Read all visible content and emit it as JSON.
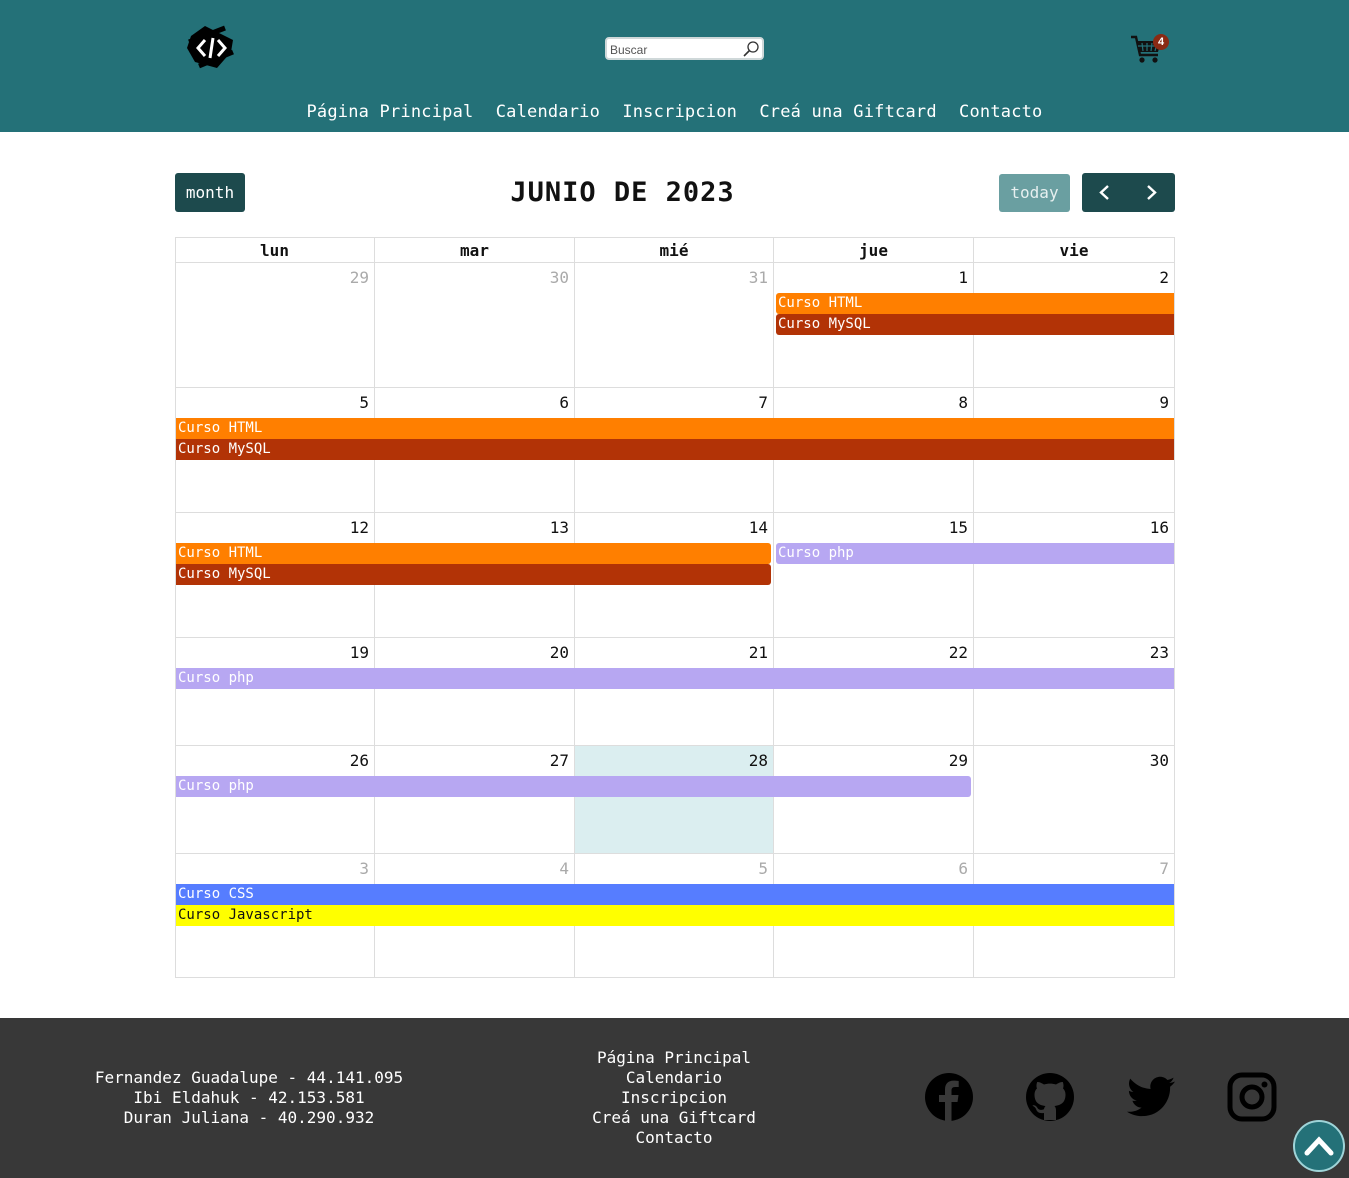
{
  "header": {
    "search_placeholder": "Buscar",
    "cart_count": "4",
    "nav": [
      "Página Principal",
      "Calendario",
      "Inscripcion",
      "Creá una Giftcard",
      "Contacto"
    ]
  },
  "toolbar": {
    "month_label": "month",
    "title": "JUNIO DE 2023",
    "today_label": "today"
  },
  "calendar": {
    "weekdays": [
      "lun",
      "mar",
      "mié",
      "jue",
      "vie"
    ],
    "weeks": [
      [
        "29",
        "30",
        "31",
        "1",
        "2"
      ],
      [
        "5",
        "6",
        "7",
        "8",
        "9"
      ],
      [
        "12",
        "13",
        "14",
        "15",
        "16"
      ],
      [
        "19",
        "20",
        "21",
        "22",
        "23"
      ],
      [
        "26",
        "27",
        "28",
        "29",
        "30"
      ],
      [
        "3",
        "4",
        "5",
        "6",
        "7"
      ]
    ],
    "events": {
      "html": "Curso HTML",
      "mysql": "Curso MySQL",
      "php": "Curso php",
      "css": "Curso CSS",
      "js": "Curso Javascript"
    },
    "colors": {
      "html": "#ff7f00",
      "mysql": "#b23306",
      "php": "#b7a7f2",
      "css": "#567dff",
      "js": "#ffff00",
      "today_bg": "#dbeef0"
    }
  },
  "footer": {
    "authors": [
      "Fernandez Guadalupe - 44.141.095",
      "Ibi Eldahuk - 42.153.581",
      "Duran Juliana - 40.290.932"
    ],
    "nav": [
      "Página Principal",
      "Calendario",
      "Inscripcion",
      "Creá una Giftcard",
      "Contacto"
    ],
    "social_icons": [
      "facebook-icon",
      "github-icon",
      "twitter-icon",
      "instagram-icon"
    ]
  },
  "theme": {
    "header_bg": "#247178",
    "dark_button": "#1d4a4d",
    "footer_bg": "#383838"
  }
}
